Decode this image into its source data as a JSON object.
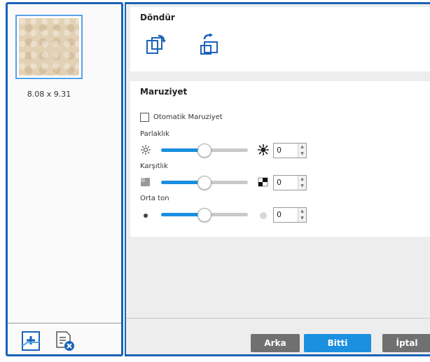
{
  "thumbnail": {
    "dimensions": "8.08 x 9.31"
  },
  "left_toolbar": {
    "add_icon": "add-page-icon",
    "delete_icon": "delete-page-icon"
  },
  "rotate": {
    "title": "Döndür",
    "buttons": [
      "rotate-left-icon",
      "rotate-right-icon"
    ]
  },
  "exposure": {
    "title": "Maruziyet",
    "auto_label": "Otomatik Maruziyet",
    "auto_checked": false,
    "sliders": [
      {
        "label": "Parlaklık",
        "value": "0",
        "level": 0.5,
        "icon_left": "sun-low-icon",
        "icon_right": "sun-high-icon"
      },
      {
        "label": "Karşıtlık",
        "value": "0",
        "level": 0.5,
        "icon_left": "contrast-low-icon",
        "icon_right": "contrast-high-icon"
      },
      {
        "label": "Orta ton",
        "value": "0",
        "level": 0.5,
        "icon_left": "dot-dark-icon",
        "icon_right": "dot-light-icon"
      }
    ]
  },
  "footer": {
    "back": "Arka",
    "done": "Bitti",
    "cancel": "İptal"
  },
  "colors": {
    "accent": "#1a62b8",
    "primary_button": "#1b8fe0",
    "secondary_button": "#707070"
  }
}
